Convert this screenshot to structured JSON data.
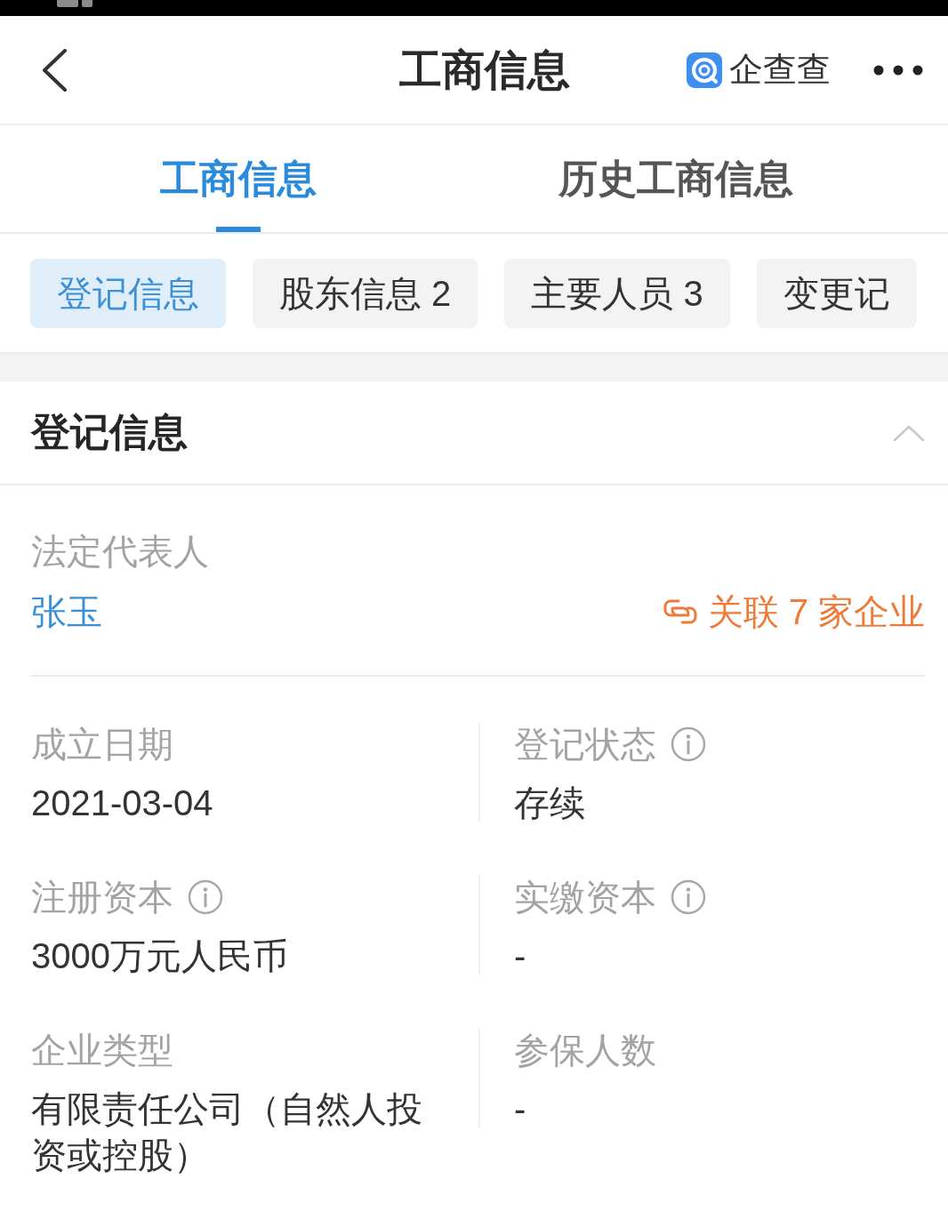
{
  "header": {
    "title": "工商信息",
    "brand": "企查查"
  },
  "tabs": [
    {
      "label": "工商信息",
      "selected": true
    },
    {
      "label": "历史工商信息",
      "selected": false
    }
  ],
  "chips": [
    {
      "label": "登记信息",
      "selected": true
    },
    {
      "label": "股东信息 2",
      "selected": false
    },
    {
      "label": "主要人员 3",
      "selected": false
    },
    {
      "label": "变更记",
      "selected": false
    }
  ],
  "section": {
    "title": "登记信息",
    "expanded": true
  },
  "legal_rep": {
    "label": "法定代表人",
    "name": "张玉",
    "related": "关联 7 家企业"
  },
  "fields": [
    {
      "label": "成立日期",
      "value": "2021-03-04",
      "info": false
    },
    {
      "label": "登记状态",
      "value": "存续",
      "info": true
    },
    {
      "label": "注册资本",
      "value": "3000万元人民币",
      "info": true
    },
    {
      "label": "实缴资本",
      "value": "-",
      "info": true
    },
    {
      "label": "企业类型",
      "value": "有限责任公司（自然人投资或控股）",
      "info": false
    },
    {
      "label": "参保人数",
      "value": "-",
      "info": false
    }
  ]
}
